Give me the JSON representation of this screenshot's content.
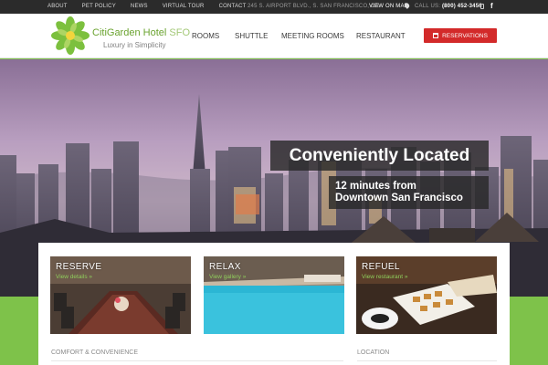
{
  "topbar": {
    "links": [
      "ABOUT",
      "PET POLICY",
      "NEWS",
      "VIRTUAL TOUR",
      "CONTACT"
    ],
    "address": "245 S. AIRPORT BLVD., S. SAN FRANCISCO, CA",
    "map_link": "VIEW ON MAP",
    "call_label": "CALL US:",
    "phone": "(800) 452-3456",
    "facebook": "f"
  },
  "header": {
    "hotel_name": "CitiGarden Hotel",
    "hotel_name_suffix": "SFO",
    "tagline": "Luxury in Simplicity",
    "nav": [
      "ROOMS",
      "SHUTTLE",
      "MEETING ROOMS",
      "RESTAURANT"
    ],
    "reservations_label": "RESERVATIONS"
  },
  "hero": {
    "title": "Conveniently Located",
    "subtitle_line1": "12 minutes from",
    "subtitle_line2": "Downtown San Francisco"
  },
  "tiles": [
    {
      "title": "RESERVE",
      "link": "View details »"
    },
    {
      "title": "RELAX",
      "link": "View gallery »"
    },
    {
      "title": "REFUEL",
      "link": "View restaurant »"
    }
  ],
  "sections": {
    "comfort": "COMFORT & CONVENIENCE",
    "location": "LOCATION"
  },
  "colors": {
    "accent_green": "#7ec24a",
    "reservations_red": "#d32a2a",
    "topbar": "#2b2b2b"
  }
}
